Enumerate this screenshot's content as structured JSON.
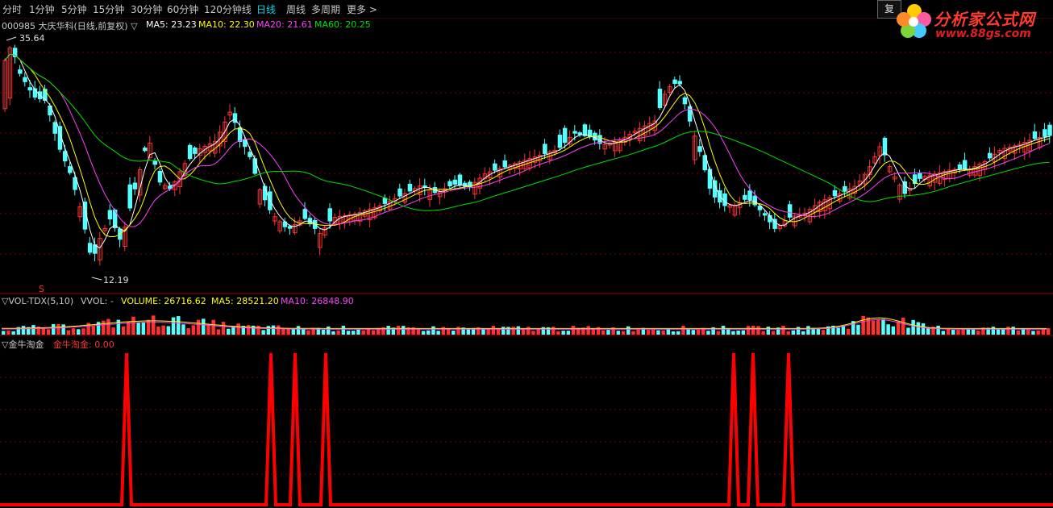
{
  "toolbar": {
    "tabs": [
      {
        "label": "分时"
      },
      {
        "label": "1分钟"
      },
      {
        "label": "5分钟"
      },
      {
        "label": "15分钟"
      },
      {
        "label": "30分钟"
      },
      {
        "label": "60分钟"
      },
      {
        "label": "120分钟线"
      },
      {
        "label": "日线",
        "active": true
      },
      {
        "label": "周线"
      },
      {
        "label": "多周期"
      },
      {
        "label": "更多 >"
      }
    ],
    "restore_btn": "复"
  },
  "logo": {
    "brand": "分析家公式网",
    "site": "www.88gs.com"
  },
  "stock": {
    "code_name": "000985 大庆华科(日线,前复权) ▽",
    "ma5_label": "MA5: 23.23",
    "ma10_label": "MA10: 22.30",
    "ma20_label": "MA20: 21.61",
    "ma60_label": "MA60: 20.25",
    "high_label": "35.64",
    "low_label": "12.19",
    "marker": "S"
  },
  "volume_panel": {
    "name": "▽VOL-TDX(5,10)",
    "vvol": "VVOL: -",
    "volume_label": "VOLUME: 26716.62",
    "ma5_label": "MA5: 28521.20",
    "ma10_label": "MA10: 26848.90"
  },
  "indicator_panel": {
    "name": "▽金牛淘金",
    "value_label": "金牛淘金: 0.00",
    "spike_x": [
      157,
      336,
      366,
      404,
      910,
      934,
      978
    ]
  },
  "colors": {
    "up": "#ff3232",
    "down": "#54ffff",
    "ma5": "#ffffff",
    "ma10": "#ffff00",
    "ma20": "#ff40ff",
    "ma60": "#00e000",
    "grid": "#7a0000"
  }
}
